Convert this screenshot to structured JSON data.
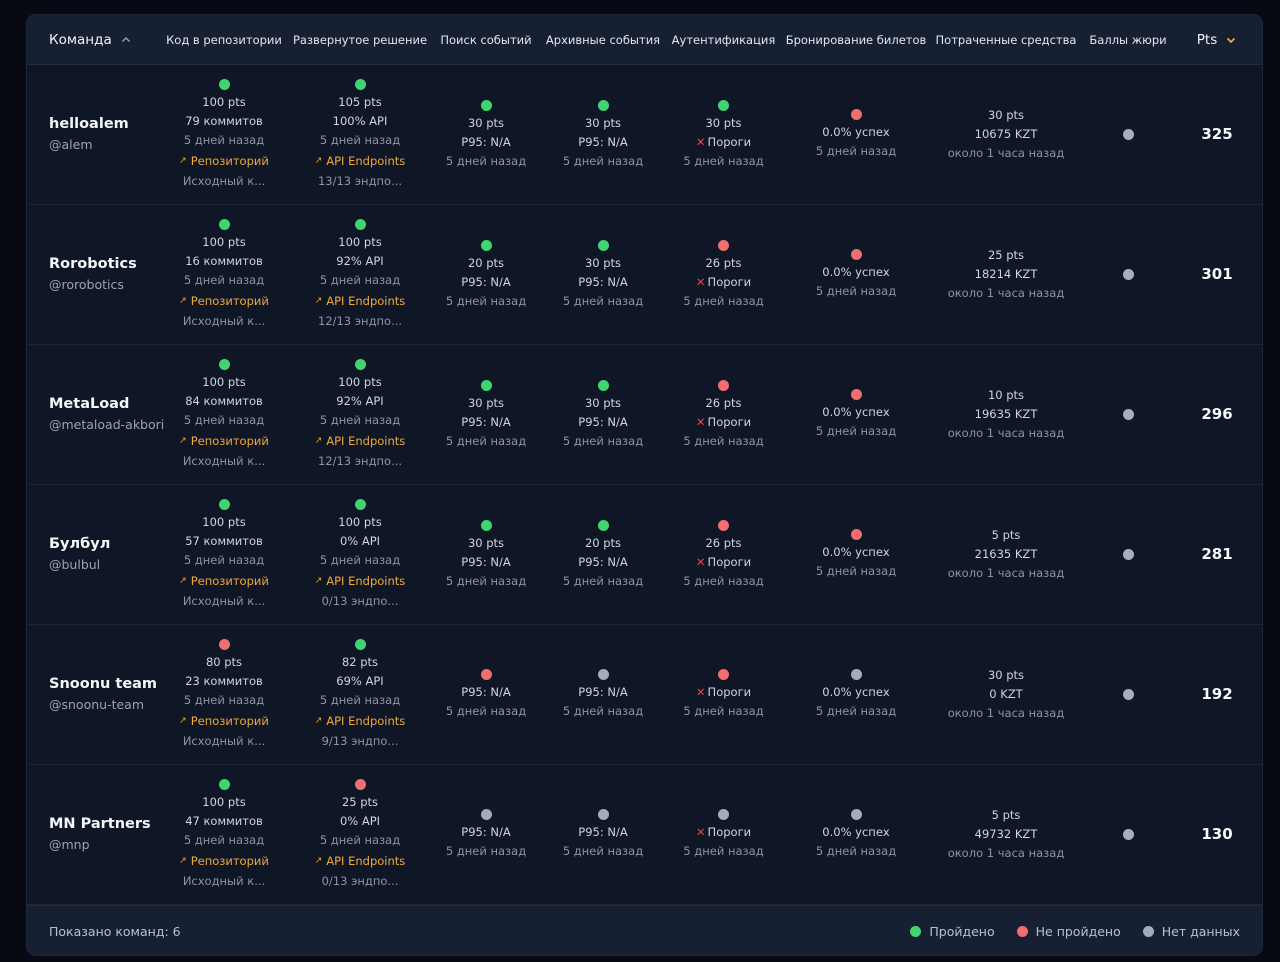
{
  "columns": {
    "team": "Команда",
    "repo": "Код в репозитории",
    "deploy": "Развернутое решение",
    "search": "Поиск событий",
    "archive": "Архивные события",
    "auth": "Аутентификация",
    "booking": "Бронирование билетов",
    "spent": "Потраченные средства",
    "jury": "Баллы жюри",
    "pts": "Pts"
  },
  "rows": [
    {
      "name": "helloalem",
      "handle": "@alem",
      "repo": {
        "status": "passed",
        "pts": "100 pts",
        "commits": "79 коммитов",
        "time": "5 дней назад",
        "link": "Репозиторий",
        "note": "Исходный к..."
      },
      "deploy": {
        "status": "passed",
        "pts": "105 pts",
        "api": "100% API",
        "time": "5 дней назад",
        "link": "API Endpoints",
        "note": "13/13 эндпо..."
      },
      "search": {
        "status": "passed",
        "pts": "30 pts",
        "p95": "P95: N/A",
        "time": "5 дней назад"
      },
      "archive": {
        "status": "passed",
        "pts": "30 pts",
        "p95": "P95: N/A",
        "time": "5 дней назад"
      },
      "auth": {
        "status": "passed",
        "pts": "30 pts",
        "label": "Пороги",
        "time": "5 дней назад"
      },
      "booking": {
        "status": "failed",
        "success": "0.0% успех",
        "time": "5 дней назад"
      },
      "spent": {
        "pts": "30 pts",
        "amount": "10675 KZT",
        "time": "около 1 часа назад"
      },
      "total": "325"
    },
    {
      "name": "Rorobotics",
      "handle": "@rorobotics",
      "repo": {
        "status": "passed",
        "pts": "100 pts",
        "commits": "16 коммитов",
        "time": "5 дней назад",
        "link": "Репозиторий",
        "note": "Исходный к..."
      },
      "deploy": {
        "status": "passed",
        "pts": "100 pts",
        "api": "92% API",
        "time": "5 дней назад",
        "link": "API Endpoints",
        "note": "12/13 эндпо..."
      },
      "search": {
        "status": "passed",
        "pts": "20 pts",
        "p95": "P95: N/A",
        "time": "5 дней назад"
      },
      "archive": {
        "status": "passed",
        "pts": "30 pts",
        "p95": "P95: N/A",
        "time": "5 дней назад"
      },
      "auth": {
        "status": "failed",
        "pts": "26 pts",
        "label": "Пороги",
        "time": "5 дней назад"
      },
      "booking": {
        "status": "failed",
        "success": "0.0% успех",
        "time": "5 дней назад"
      },
      "spent": {
        "pts": "25 pts",
        "amount": "18214 KZT",
        "time": "около 1 часа назад"
      },
      "total": "301"
    },
    {
      "name": "MetaLoad",
      "handle": "@metaload-akbori",
      "repo": {
        "status": "passed",
        "pts": "100 pts",
        "commits": "84 коммитов",
        "time": "5 дней назад",
        "link": "Репозиторий",
        "note": "Исходный к..."
      },
      "deploy": {
        "status": "passed",
        "pts": "100 pts",
        "api": "92% API",
        "time": "5 дней назад",
        "link": "API Endpoints",
        "note": "12/13 эндпо..."
      },
      "search": {
        "status": "passed",
        "pts": "30 pts",
        "p95": "P95: N/A",
        "time": "5 дней назад"
      },
      "archive": {
        "status": "passed",
        "pts": "30 pts",
        "p95": "P95: N/A",
        "time": "5 дней назад"
      },
      "auth": {
        "status": "failed",
        "pts": "26 pts",
        "label": "Пороги",
        "time": "5 дней назад"
      },
      "booking": {
        "status": "failed",
        "success": "0.0% успех",
        "time": "5 дней назад"
      },
      "spent": {
        "pts": "10 pts",
        "amount": "19635 KZT",
        "time": "около 1 часа назад"
      },
      "total": "296"
    },
    {
      "name": "Булбул",
      "handle": "@bulbul",
      "repo": {
        "status": "passed",
        "pts": "100 pts",
        "commits": "57 коммитов",
        "time": "5 дней назад",
        "link": "Репозиторий",
        "note": "Исходный к..."
      },
      "deploy": {
        "status": "passed",
        "pts": "100 pts",
        "api": "0% API",
        "time": "5 дней назад",
        "link": "API Endpoints",
        "note": "0/13 эндпо..."
      },
      "search": {
        "status": "passed",
        "pts": "30 pts",
        "p95": "P95: N/A",
        "time": "5 дней назад"
      },
      "archive": {
        "status": "passed",
        "pts": "20 pts",
        "p95": "P95: N/A",
        "time": "5 дней назад"
      },
      "auth": {
        "status": "failed",
        "pts": "26 pts",
        "label": "Пороги",
        "time": "5 дней назад"
      },
      "booking": {
        "status": "failed",
        "success": "0.0% успех",
        "time": "5 дней назад"
      },
      "spent": {
        "pts": "5 pts",
        "amount": "21635 KZT",
        "time": "около 1 часа назад"
      },
      "total": "281"
    },
    {
      "name": "Snoonu team",
      "handle": "@snoonu-team",
      "repo": {
        "status": "failed",
        "pts": "80 pts",
        "commits": "23 коммитов",
        "time": "5 дней назад",
        "link": "Репозиторий",
        "note": "Исходный к..."
      },
      "deploy": {
        "status": "passed",
        "pts": "82 pts",
        "api": "69% API",
        "time": "5 дней назад",
        "link": "API Endpoints",
        "note": "9/13 эндпо..."
      },
      "search": {
        "status": "failed",
        "pts": "",
        "p95": "P95: N/A",
        "time": "5 дней назад"
      },
      "archive": {
        "status": "nodata",
        "pts": "",
        "p95": "P95: N/A",
        "time": "5 дней назад"
      },
      "auth": {
        "status": "failed",
        "pts": "",
        "label": "Пороги",
        "time": "5 дней назад"
      },
      "booking": {
        "status": "nodata",
        "success": "0.0% успех",
        "time": "5 дней назад"
      },
      "spent": {
        "pts": "30 pts",
        "amount": "0 KZT",
        "time": "около 1 часа назад"
      },
      "total": "192"
    },
    {
      "name": "MN Partners",
      "handle": "@mnp",
      "repo": {
        "status": "passed",
        "pts": "100 pts",
        "commits": "47 коммитов",
        "time": "5 дней назад",
        "link": "Репозиторий",
        "note": "Исходный к..."
      },
      "deploy": {
        "status": "failed",
        "pts": "25 pts",
        "api": "0% API",
        "time": "5 дней назад",
        "link": "API Endpoints",
        "note": "0/13 эндпо..."
      },
      "search": {
        "status": "nodata",
        "pts": "",
        "p95": "P95: N/A",
        "time": "5 дней назад"
      },
      "archive": {
        "status": "nodata",
        "pts": "",
        "p95": "P95: N/A",
        "time": "5 дней назад"
      },
      "auth": {
        "status": "nodata",
        "pts": "",
        "label": "Пороги",
        "time": "5 дней назад"
      },
      "booking": {
        "status": "nodata",
        "success": "0.0% успех",
        "time": "5 дней назад"
      },
      "spent": {
        "pts": "5 pts",
        "amount": "49732 KZT",
        "time": "около 1 часа назад"
      },
      "total": "130"
    }
  ],
  "footer": {
    "count": "Показано команд: 6",
    "legend": {
      "passed": "Пройдено",
      "failed": "Не пройдено",
      "nodata": "Нет данных"
    }
  },
  "colors": {
    "passed": "#3fd66f",
    "failed": "#f26d6d",
    "nodata": "#a4acbb",
    "accent": "#f0a93a"
  },
  "icons": {
    "sort_team": "chevron-up-icon",
    "sort_pts": "chevron-down-icon",
    "link": "external-link-icon",
    "fail": "cross-icon"
  }
}
